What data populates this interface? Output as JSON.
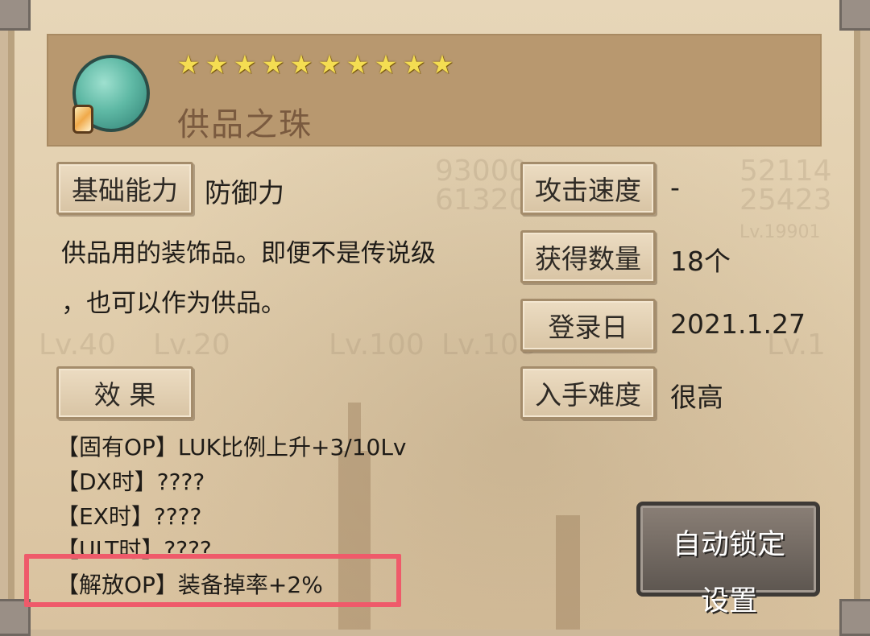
{
  "item": {
    "name": "供品之珠",
    "stars": [
      "★",
      "★",
      "★",
      "★",
      "★",
      "★",
      "★",
      "★",
      "★",
      "★"
    ]
  },
  "info": {
    "base_ability_label": "基础能力",
    "base_ability_value": "防御力",
    "attack_speed_label": "攻击速度",
    "attack_speed_value": "-",
    "obtained_label": "获得数量",
    "obtained_value": "18个",
    "register_label": "登录日",
    "register_value": "2021.1.27",
    "difficulty_label": "入手难度",
    "difficulty_value": "很高"
  },
  "description": {
    "line1": "供品用的装饰品。即便不是传说级",
    "line2": "，也可以作为供品。"
  },
  "effects": {
    "button_label": "效 果",
    "lines": [
      "【固有OP】LUK比例上升+3/10Lv",
      "【DX时】????",
      "【EX时】????",
      "【ULT时】????",
      "【解放OP】装备掉率+2%"
    ]
  },
  "auto_lock": {
    "line1": "自动锁定",
    "line2": "设置"
  },
  "background_text": [
    "93000",
    "61320",
    "52114",
    "25423",
    "Lv.40",
    "Lv.20",
    "Lv.100",
    "Lv.100",
    "Lv.1",
    "Lv.19901"
  ],
  "colors": {
    "highlight": "#ef5a6a",
    "stars": "#f4dd52"
  },
  "icons": {
    "orb": "green-orb-icon",
    "gem": "orange-gem-icon"
  }
}
